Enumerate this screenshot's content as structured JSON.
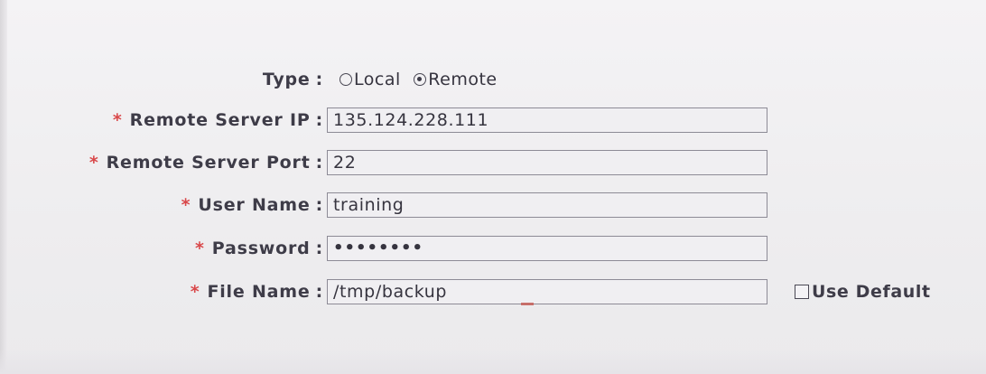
{
  "form": {
    "type": {
      "label": "Type",
      "options": [
        {
          "label": "Local",
          "selected": false
        },
        {
          "label": "Remote",
          "selected": true
        }
      ]
    },
    "remote_server_ip": {
      "label": "Remote Server IP",
      "value": "135.124.228.111",
      "required": true
    },
    "remote_server_port": {
      "label": "Remote Server Port",
      "value": "22",
      "required": true
    },
    "user_name": {
      "label": "User Name",
      "value": "training",
      "required": true
    },
    "password": {
      "label": "Password",
      "value": "••••••••",
      "required": true
    },
    "file_name": {
      "label": "File Name",
      "value": "/tmp/backup",
      "required": true
    },
    "use_default": {
      "label": "Use Default",
      "checked": false
    }
  },
  "symbols": {
    "required_marker": "*",
    "separator": ":"
  },
  "colors": {
    "required": "#d9484a",
    "label": "#3e3c48",
    "field_border": "#8d8b96"
  }
}
